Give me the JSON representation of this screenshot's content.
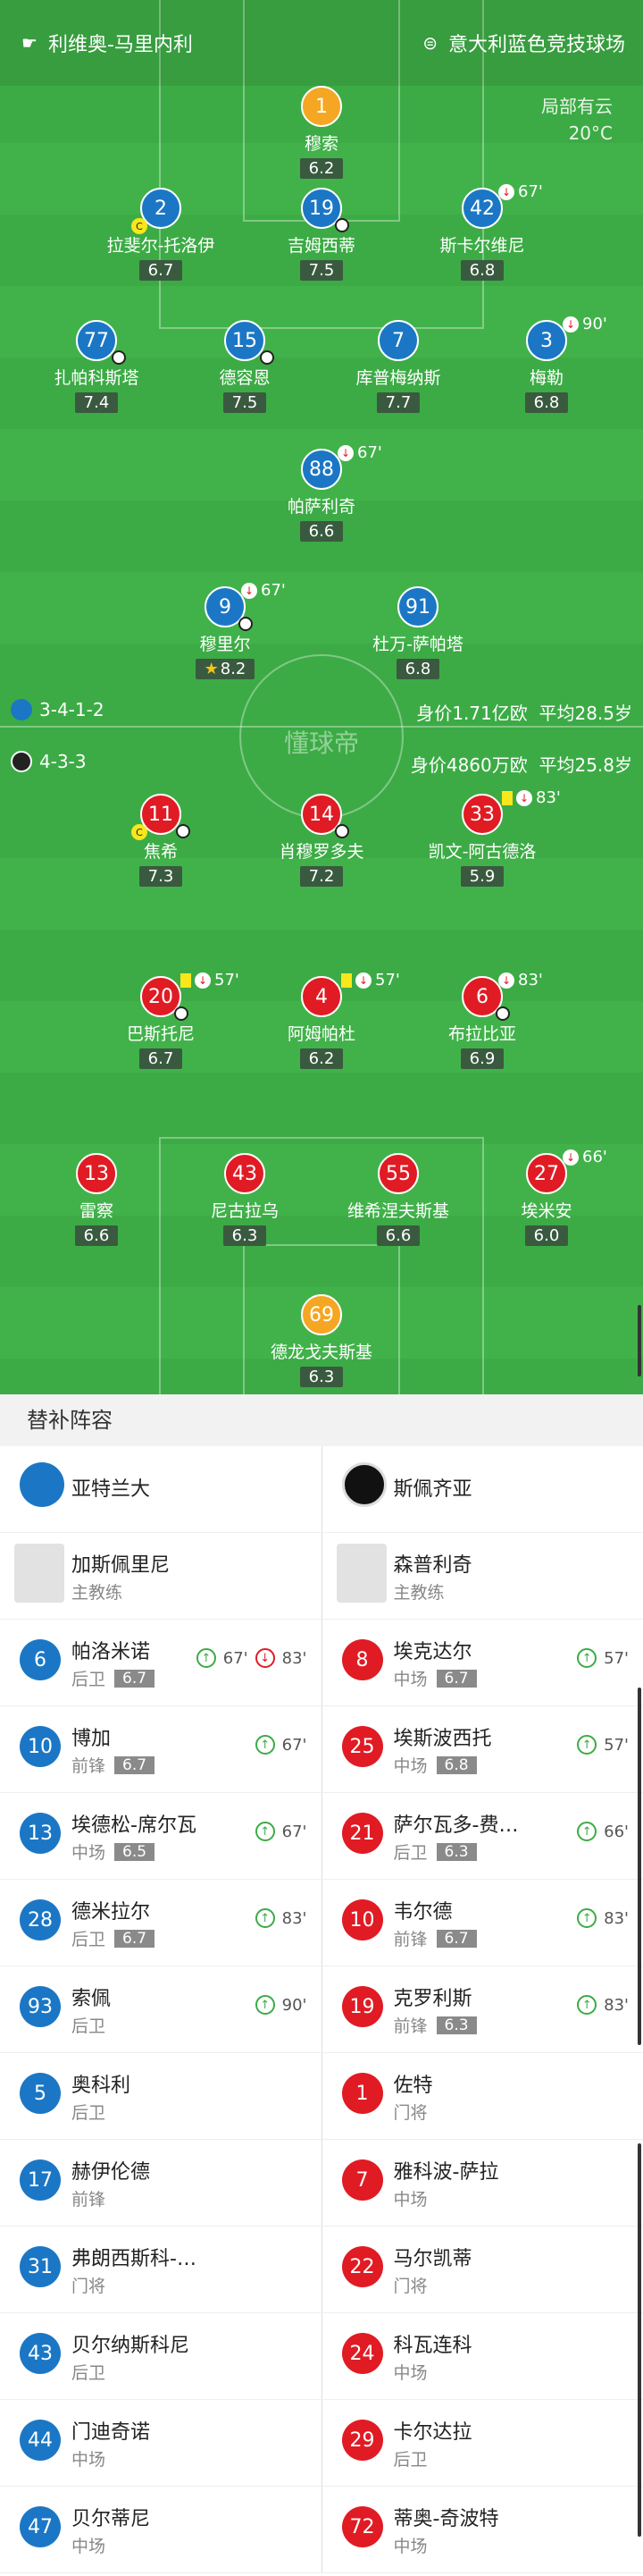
{
  "header": {
    "match": "利维奥-马里内利",
    "venue": "意大利蓝色竞技球场",
    "weather": "局部有云",
    "temperature": "20°C"
  },
  "home": {
    "formation": "3-4-1-2",
    "value": "身价1.71亿欧",
    "avg_age": "平均28.5岁",
    "name": "亚特兰大",
    "coach": "加斯佩里尼",
    "coach_role": "主教练",
    "players": [
      {
        "num": "1",
        "name": "穆索",
        "rating": "6.2"
      },
      {
        "num": "2",
        "name": "拉斐尔-托洛伊",
        "rating": "6.7",
        "cap": "C"
      },
      {
        "num": "19",
        "name": "吉姆西蒂",
        "rating": "7.5"
      },
      {
        "num": "42",
        "name": "斯卡尔维尼",
        "rating": "6.8",
        "sub": "67'"
      },
      {
        "num": "77",
        "name": "扎帕科斯塔",
        "rating": "7.4"
      },
      {
        "num": "15",
        "name": "德容恩",
        "rating": "7.5"
      },
      {
        "num": "7",
        "name": "库普梅纳斯",
        "rating": "7.7"
      },
      {
        "num": "3",
        "name": "梅勒",
        "rating": "6.8",
        "sub": "90'"
      },
      {
        "num": "88",
        "name": "帕萨利奇",
        "rating": "6.6",
        "sub": "67'"
      },
      {
        "num": "9",
        "name": "穆里尔",
        "rating": "8.2",
        "sub": "67'"
      },
      {
        "num": "91",
        "name": "杜万-萨帕塔",
        "rating": "6.8"
      }
    ]
  },
  "away": {
    "formation": "4-3-3",
    "value": "身价4860万欧",
    "avg_age": "平均25.8岁",
    "name": "斯佩齐亚",
    "coach": "森普利奇",
    "coach_role": "主教练",
    "players": [
      {
        "num": "11",
        "name": "焦希",
        "rating": "7.3",
        "cap": "C"
      },
      {
        "num": "14",
        "name": "肖穆罗多夫",
        "rating": "7.2"
      },
      {
        "num": "33",
        "name": "凯文-阿古德洛",
        "rating": "5.9",
        "sub": "83'"
      },
      {
        "num": "20",
        "name": "巴斯托尼",
        "rating": "6.7",
        "sub": "57'"
      },
      {
        "num": "4",
        "name": "阿姆帕杜",
        "rating": "6.2",
        "sub": "57'"
      },
      {
        "num": "6",
        "name": "布拉比亚",
        "rating": "6.9",
        "sub": "83'"
      },
      {
        "num": "13",
        "name": "雷察",
        "rating": "6.6"
      },
      {
        "num": "43",
        "name": "尼古拉乌",
        "rating": "6.3"
      },
      {
        "num": "55",
        "name": "维希涅夫斯基",
        "rating": "6.6"
      },
      {
        "num": "27",
        "name": "埃米安",
        "rating": "6.0",
        "sub": "66'"
      },
      {
        "num": "69",
        "name": "德龙戈夫斯基",
        "rating": "6.3"
      }
    ]
  },
  "watermark": "懂球帝",
  "subs_title": "替补阵容",
  "subs": [
    [
      {
        "num": "6",
        "name": "帕洛米诺",
        "pos": "后卫",
        "rating": "6.7",
        "in": "67'",
        "out": "83'"
      },
      {
        "num": "8",
        "name": "埃克达尔",
        "pos": "中场",
        "rating": "6.7",
        "in": "57'"
      }
    ],
    [
      {
        "num": "10",
        "name": "博加",
        "pos": "前锋",
        "rating": "6.7",
        "in": "67'"
      },
      {
        "num": "25",
        "name": "埃斯波西托",
        "pos": "中场",
        "rating": "6.8",
        "in": "57'"
      }
    ],
    [
      {
        "num": "13",
        "name": "埃德松-席尔瓦",
        "pos": "中场",
        "rating": "6.5",
        "in": "67'"
      },
      {
        "num": "21",
        "name": "萨尔瓦多-费…",
        "pos": "后卫",
        "rating": "6.3",
        "in": "66'"
      }
    ],
    [
      {
        "num": "28",
        "name": "德米拉尔",
        "pos": "后卫",
        "rating": "6.7",
        "in": "83'"
      },
      {
        "num": "10",
        "name": "韦尔德",
        "pos": "前锋",
        "rating": "6.7",
        "in": "83'"
      }
    ],
    [
      {
        "num": "93",
        "name": "索佩",
        "pos": "后卫",
        "rating": "",
        "in": "90'"
      },
      {
        "num": "19",
        "name": "克罗利斯",
        "pos": "前锋",
        "rating": "6.3",
        "in": "83'"
      }
    ],
    [
      {
        "num": "5",
        "name": "奥科利",
        "pos": "后卫"
      },
      {
        "num": "1",
        "name": "佐特",
        "pos": "门将"
      }
    ],
    [
      {
        "num": "17",
        "name": "赫伊伦德",
        "pos": "前锋"
      },
      {
        "num": "7",
        "name": "雅科波-萨拉",
        "pos": "中场"
      }
    ],
    [
      {
        "num": "31",
        "name": "弗朗西斯科-…",
        "pos": "门将"
      },
      {
        "num": "22",
        "name": "马尔凯蒂",
        "pos": "门将"
      }
    ],
    [
      {
        "num": "43",
        "name": "贝尔纳斯科尼",
        "pos": "后卫"
      },
      {
        "num": "24",
        "name": "科瓦连科",
        "pos": "中场"
      }
    ],
    [
      {
        "num": "44",
        "name": "门迪奇诺",
        "pos": "中场"
      },
      {
        "num": "29",
        "name": "卡尔达拉",
        "pos": "后卫"
      }
    ],
    [
      {
        "num": "47",
        "name": "贝尔蒂尼",
        "pos": "中场"
      },
      {
        "num": "72",
        "name": "蒂奥-奇波特",
        "pos": "中场"
      }
    ]
  ]
}
